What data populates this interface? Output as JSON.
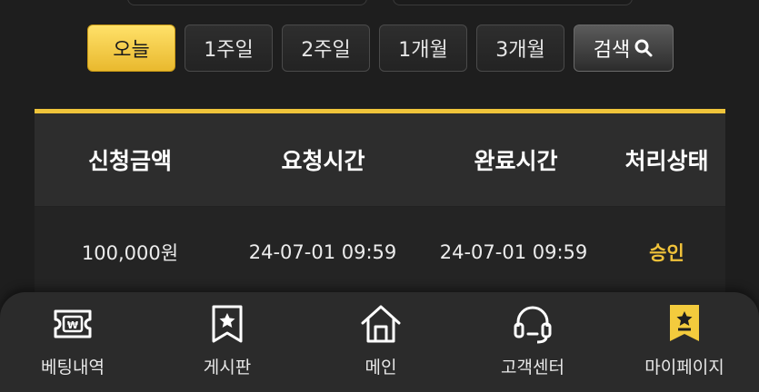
{
  "filters": {
    "today": "오늘",
    "week1": "1주일",
    "week2": "2주일",
    "month1": "1개월",
    "month3": "3개월",
    "search": "검색"
  },
  "table": {
    "headers": [
      "신청금액",
      "요청시간",
      "완료시간",
      "처리상태"
    ],
    "rows": [
      {
        "amount": "100,000원",
        "requested": "24-07-01 09:59",
        "completed": "24-07-01 09:59",
        "status": "승인"
      }
    ]
  },
  "nav": {
    "items": [
      {
        "label": "베팅내역",
        "icon": "ticket-won-icon"
      },
      {
        "label": "게시판",
        "icon": "board-star-icon"
      },
      {
        "label": "메인",
        "icon": "home-icon"
      },
      {
        "label": "고객센터",
        "icon": "headset-icon"
      },
      {
        "label": "마이페이지",
        "icon": "bookmark-star-icon"
      }
    ]
  },
  "colors": {
    "accent": "#efc43a",
    "background": "#1e1e1e",
    "status_approved": "#f0c23a"
  }
}
